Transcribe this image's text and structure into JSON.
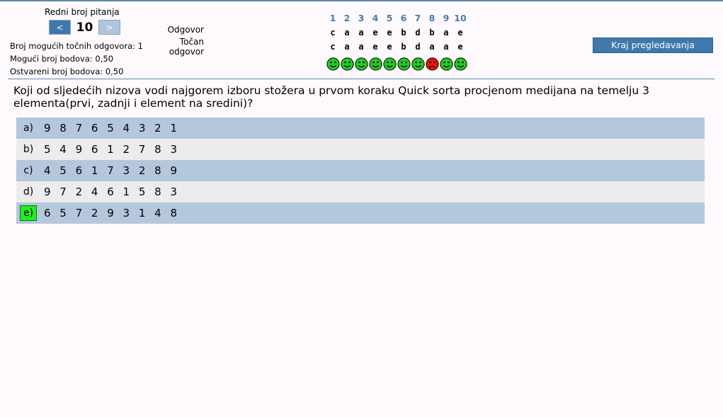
{
  "nav": {
    "title": "Redni broj pitanja",
    "prev": "<",
    "current": "10",
    "next": ">"
  },
  "info": {
    "possible_correct": "Broj mogućih točnih odgovora: 1",
    "possible_points": "Mogući broj bodova: 0,50",
    "achieved_points": "Ostvareni broj bodova: 0,50"
  },
  "legend": {
    "answer": "Odgovor",
    "correct_1": "Točan",
    "correct_2": "odgovor"
  },
  "questions": [
    {
      "n": "1",
      "answer": "c",
      "correct": "c",
      "result": "correct"
    },
    {
      "n": "2",
      "answer": "a",
      "correct": "a",
      "result": "correct"
    },
    {
      "n": "3",
      "answer": "a",
      "correct": "a",
      "result": "correct"
    },
    {
      "n": "4",
      "answer": "e",
      "correct": "e",
      "result": "correct"
    },
    {
      "n": "5",
      "answer": "e",
      "correct": "e",
      "result": "correct"
    },
    {
      "n": "6",
      "answer": "b",
      "correct": "b",
      "result": "correct"
    },
    {
      "n": "7",
      "answer": "d",
      "correct": "d",
      "result": "correct"
    },
    {
      "n": "8",
      "answer": "b",
      "correct": "a",
      "result": "wrong"
    },
    {
      "n": "9",
      "answer": "a",
      "correct": "a",
      "result": "correct"
    },
    {
      "n": "10",
      "answer": "e",
      "correct": "e",
      "result": "correct"
    }
  ],
  "end_button": "Kraj pregledavanja",
  "question_text": "Koji od sljedećih nizova vodi najgorem izboru stožera u prvom koraku Quick sorta procjenom medijana na temelju 3 elementa(prvi, zadnji i element na sredini)?",
  "options": [
    {
      "letter": "a)",
      "text": "9 8 7 6 5 4 3 2 1",
      "correct": false
    },
    {
      "letter": "b)",
      "text": "5 4 9 6 1 2 7 8 3",
      "correct": false
    },
    {
      "letter": "c)",
      "text": "4 5 6 1 7 3 2 8 9",
      "correct": false
    },
    {
      "letter": "d)",
      "text": "9 7 2 4 6 1 5 8 3",
      "correct": false
    },
    {
      "letter": "e)",
      "text": "6 5 7 2 9 3 1 4 8",
      "correct": true
    }
  ],
  "colors": {
    "correct_face": "#22cc22",
    "wrong_face": "#ee1111",
    "accent": "#3f78ab"
  }
}
